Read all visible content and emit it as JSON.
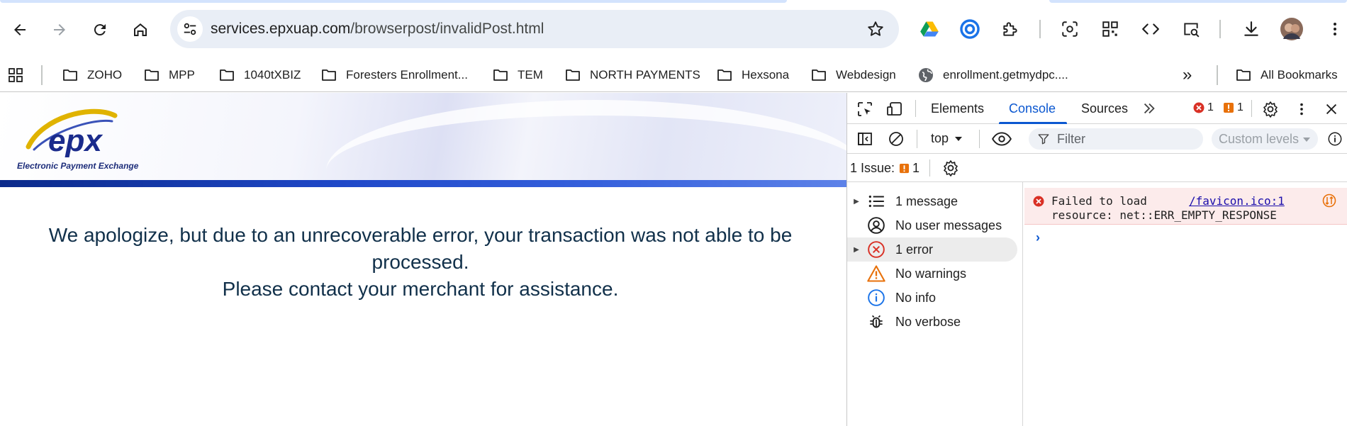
{
  "toolbar": {
    "url_host": "services.epxuap.com",
    "url_path": "/browserpost/invalidPost.html"
  },
  "bookmarks": {
    "items": [
      {
        "label": "ZOHO",
        "icon": "folder-icon"
      },
      {
        "label": "MPP",
        "icon": "folder-icon"
      },
      {
        "label": "1040tXBIZ",
        "icon": "folder-icon"
      },
      {
        "label": "Foresters Enrollment...",
        "icon": "folder-icon"
      },
      {
        "label": "TEM",
        "icon": "folder-icon"
      },
      {
        "label": "NORTH PAYMENTS",
        "icon": "folder-icon"
      },
      {
        "label": "Hexsona",
        "icon": "folder-icon"
      },
      {
        "label": "Webdesign",
        "icon": "folder-icon"
      },
      {
        "label": "enrollment.getmydpc....",
        "icon": "globe-icon"
      }
    ],
    "overflow": "»",
    "all_bookmarks": "All Bookmarks"
  },
  "page": {
    "logo_text": "epx",
    "logo_caption": "Electronic Payment Exchange",
    "message_line1": "We apologize, but due to an unrecoverable error, your transaction was not able to be processed.",
    "message_line2": "Please contact your merchant for assistance."
  },
  "devtools": {
    "tabs": [
      "Elements",
      "Console",
      "Sources"
    ],
    "active_tab": "Console",
    "error_count": "1",
    "warning_count": "1",
    "context": "top",
    "filter_placeholder": "Filter",
    "levels": "Custom levels",
    "issues_label": "1 Issue:",
    "issues_count": "1",
    "sidebar": [
      {
        "label": "1 message",
        "icon": "list-icon",
        "expandable": true
      },
      {
        "label": "No user messages",
        "icon": "user-icon",
        "expandable": false
      },
      {
        "label": "1 error",
        "icon": "error-icon",
        "expandable": true
      },
      {
        "label": "No warnings",
        "icon": "warning-icon",
        "expandable": false
      },
      {
        "label": "No info",
        "icon": "info-icon",
        "expandable": false
      },
      {
        "label": "No verbose",
        "icon": "bug-icon",
        "expandable": false
      }
    ],
    "console_error_line1": "Failed to load",
    "console_error_link": "/favicon.ico:1",
    "console_error_line2": "resource: net::ERR_EMPTY_RESPONSE",
    "prompt": "›"
  },
  "colors": {
    "accent": "#0b57d0",
    "error": "#d93025",
    "warning": "#e8710a",
    "omnibox_bg": "#e9eef6"
  }
}
